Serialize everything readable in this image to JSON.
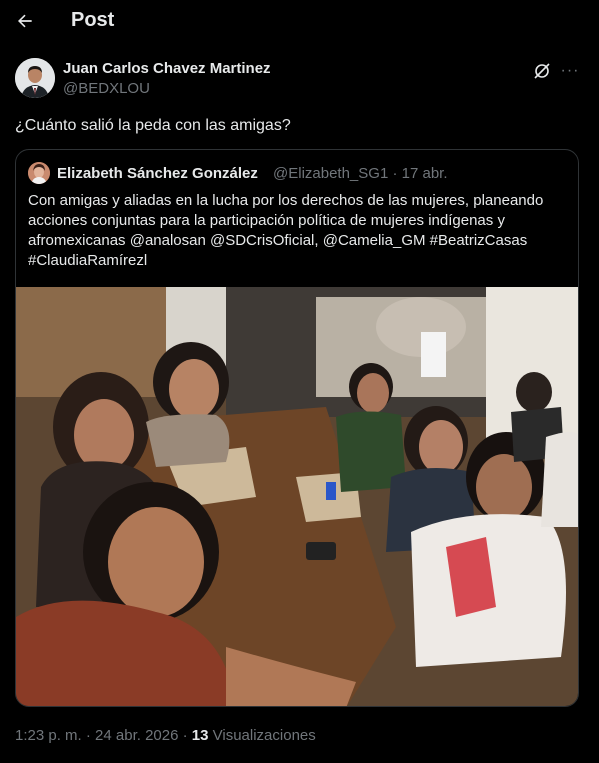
{
  "header": {
    "title": "Post",
    "back_icon": "arrow-left-icon"
  },
  "post": {
    "author_name": "Juan Carlos Chavez Martinez",
    "author_handle": "@BEDXLOU",
    "text": "¿Cuánto salió la peda con las amigas?",
    "grok_icon": "grok-icon",
    "more_label": "···"
  },
  "quoted": {
    "author_name": "Elizabeth Sánchez González",
    "meta": "@Elizabeth_SG1 · 17 abr.",
    "text": "Con amigas y aliadas en la lucha por los derechos de las mujeres, planeando\nacciones conjuntas para la participación política de mujeres indígenas y\nafromexicanas @analosan @SDCrisOficial, @Camelia_GM #BeatrizCasas\n#ClaudiaRamírezl"
  },
  "footer": {
    "time_date": "1:23 p. m. · 24 abr. 2026 · ",
    "views_count": "13",
    "views_label": " Visualizaciones"
  }
}
